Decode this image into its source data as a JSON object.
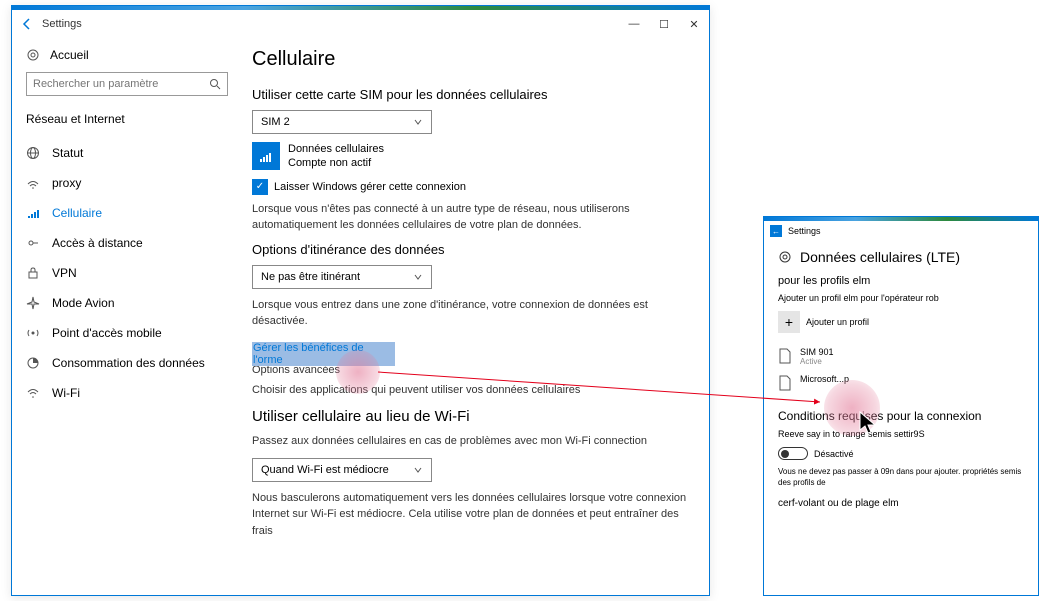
{
  "main": {
    "title": "Settings",
    "home": "Accueil",
    "search_placeholder": "Rechercher un paramètre",
    "group": "Réseau et Internet",
    "sidebar": [
      {
        "label": "Statut"
      },
      {
        "label": "proxy"
      },
      {
        "label": "Cellulaire"
      },
      {
        "label": "Accès à distance"
      },
      {
        "label": "VPN"
      },
      {
        "label": "Mode Avion"
      },
      {
        "label": "Point d'accès mobile"
      },
      {
        "label": "Consommation des données"
      },
      {
        "label": "Wi-Fi"
      }
    ],
    "heading": "Cellulaire",
    "sim_label": "Utiliser cette carte SIM pour les données cellulaires",
    "sim_value": "SIM 2",
    "data_title": "Données cellulaires",
    "data_sub": "Compte non actif",
    "chk_manage": "Laisser Windows gérer cette connexion",
    "chk_desc": "Lorsque vous n'êtes pas connecté à un autre type de réseau, nous utiliserons automatiquement les données cellulaires de votre plan de données.",
    "roam_label": "Options d'itinérance des données",
    "roam_value": "Ne pas être itinérant",
    "roam_desc": "Lorsque vous entrez dans une zone d'itinérance, votre connexion de données est désactivée.",
    "link_manage": "Gérer les bénéfices de l'orme",
    "link_adv": "Options avancées",
    "link_choose": "Choisir des applications qui peuvent utiliser vos données cellulaires",
    "wifi_heading": "Utiliser cellulaire au lieu de Wi-Fi",
    "wifi_desc": "Passez aux données cellulaires en cas de problèmes avec mon Wi-Fi connection",
    "wifi_value": "Quand Wi-Fi est médiocre",
    "wifi_note": "Nous basculerons automatiquement vers les données cellulaires lorsque votre connexion Internet sur Wi-Fi est médiocre. Cela utilise votre plan de données et peut entraîner des frais"
  },
  "sec": {
    "title": "Settings",
    "heading": "Données cellulaires (LTE)",
    "sub": "pour les profils elm",
    "desc": "Ajouter un profil elm pour l'opérateur rob",
    "add": "Ajouter un profil",
    "profiles": [
      {
        "name": "SIM 901",
        "status": "Active"
      },
      {
        "name": "Microsoft...p",
        "status": ""
      }
    ],
    "cond_title": "Conditions requises pour la connexion",
    "cond_desc": "Reeve say in to range semis settir9S",
    "toggle_label": "Désactivé",
    "note": "Vous ne devez pas passer à 09n dans pour ajouter. propriétés semis des profils de",
    "footer": "cerf-volant ou de plage elm"
  }
}
